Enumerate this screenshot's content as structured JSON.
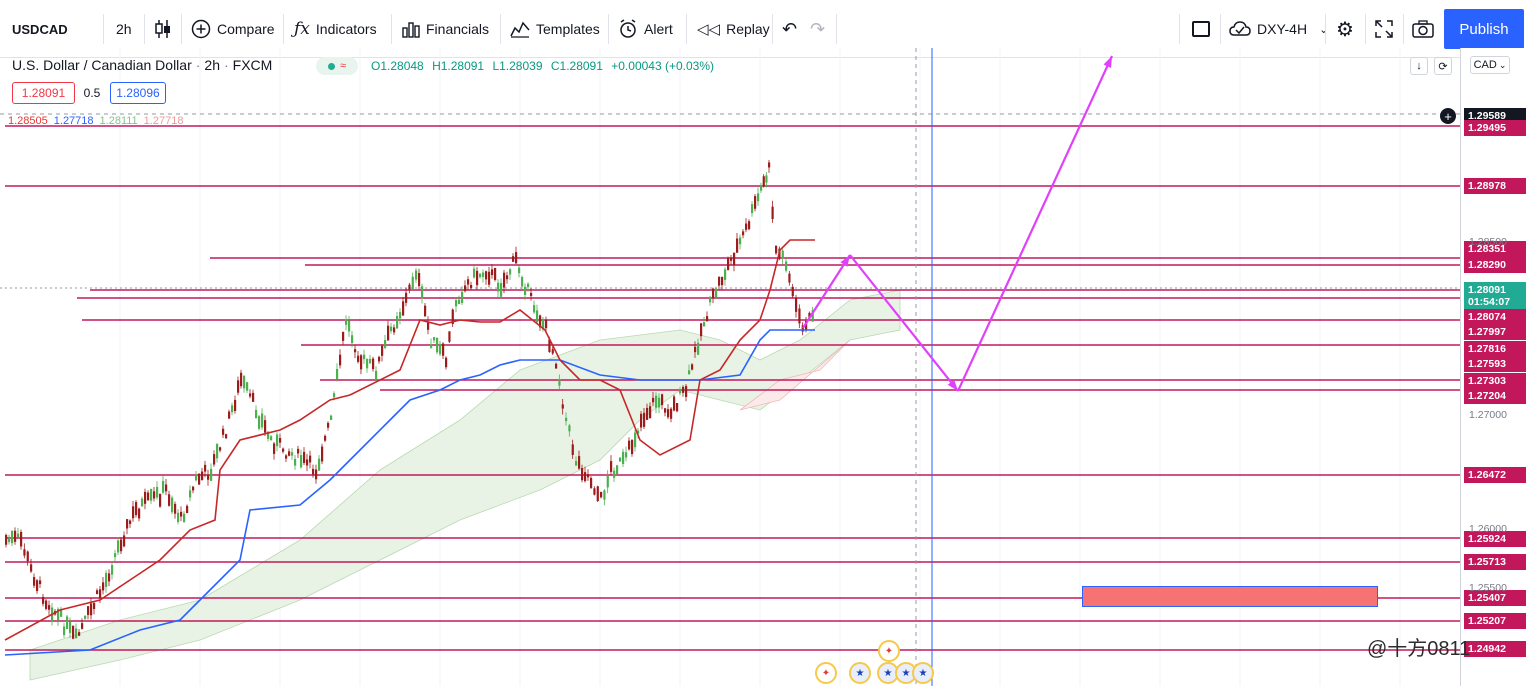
{
  "toolbar": {
    "symbol": "USDCAD",
    "interval": "2h",
    "compare_label": "Compare",
    "indicators_label": "Indicators",
    "financials_label": "Financials",
    "templates_label": "Templates",
    "alert_label": "Alert",
    "replay_label": "Replay",
    "layout_name": "DXY-4H",
    "publish_label": "Publish"
  },
  "legend": {
    "instrument": "U.S. Dollar / Canadian Dollar",
    "interval": "2h",
    "source": "FXCM",
    "status_symbol": "≈",
    "open": "O1.28048",
    "high": "H1.28091",
    "low": "L1.28039",
    "close": "C1.28091",
    "change": "+0.00043 (+0.03%)"
  },
  "bidask": {
    "bid": "1.28091",
    "spread": "0.5",
    "ask": "1.28096"
  },
  "ichimoku_values": [
    {
      "value": "1.28505",
      "color": "#e53935"
    },
    {
      "value": "1.27718",
      "color": "#2962ff"
    },
    {
      "value": "1.28111",
      "color": "#81c784"
    },
    {
      "value": "1.27718",
      "color": "#ef9a9a"
    }
  ],
  "price_axis": {
    "currency": "CAD",
    "tags": [
      {
        "price": "1.29589",
        "bg": "#131722",
        "row": 0
      },
      {
        "price": "1.29495",
        "bg": "#c2185b",
        "row": 1
      },
      {
        "price": "1.28978",
        "bg": "#c2185b",
        "row": 2
      },
      {
        "price": "1.28351",
        "bg": "#c2185b",
        "row": 3
      },
      {
        "price": "1.28290",
        "bg": "#c2185b",
        "row": 4
      },
      {
        "price": "1.28091",
        "bg": "#22ab94",
        "row": 5
      },
      {
        "price": "01:54:07",
        "bg": "#22ab94",
        "row": 6
      },
      {
        "price": "1.28074",
        "bg": "#c2185b",
        "row": 7
      },
      {
        "price": "1.27997",
        "bg": "#c2185b",
        "row": 8
      },
      {
        "price": "1.27816",
        "bg": "#c2185b",
        "row": 9
      },
      {
        "price": "1.27593",
        "bg": "#c2185b",
        "row": 10
      },
      {
        "price": "1.27303",
        "bg": "#c2185b",
        "row": 11
      },
      {
        "price": "1.27204",
        "bg": "#c2185b",
        "row": 12
      },
      {
        "price": "1.26472",
        "bg": "#c2185b",
        "row": 13
      },
      {
        "price": "1.25924",
        "bg": "#c2185b",
        "row": 14
      },
      {
        "price": "1.25713",
        "bg": "#c2185b",
        "row": 15
      },
      {
        "price": "1.25407",
        "bg": "#c2185b",
        "row": 16
      },
      {
        "price": "1.25207",
        "bg": "#c2185b",
        "row": 17
      },
      {
        "price": "1.24942",
        "bg": "#c2185b",
        "row": 18
      }
    ],
    "grid_labels": [
      "1.28500",
      "1.27000",
      "1.26000",
      "1.25500"
    ]
  },
  "watermark": "@十方0811",
  "colors": {
    "accent": "#2962ff",
    "level_line": "#c2185b",
    "projection": "#e040fb",
    "candle_up": "#4caf50",
    "candle_down": "#9c1b1b"
  },
  "icons": [
    "candlestick-icon",
    "compare-icon",
    "indicators-icon",
    "financials-icon",
    "templates-icon",
    "alert-icon",
    "replay-icon",
    "undo-icon",
    "redo-icon",
    "layout-icon",
    "cloud-icon",
    "settings-icon",
    "fullscreen-icon",
    "camera-icon"
  ]
}
